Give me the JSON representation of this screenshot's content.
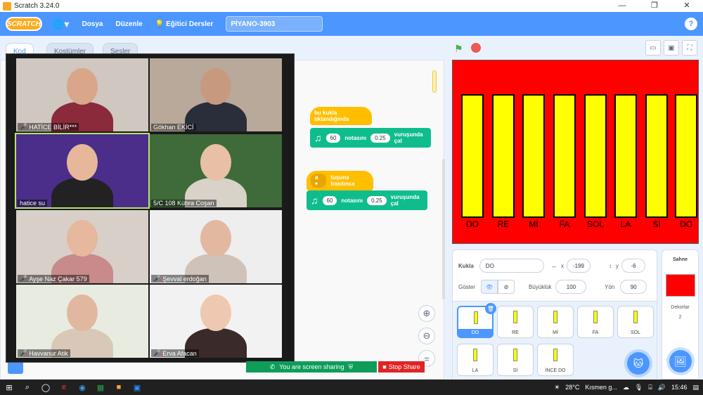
{
  "window": {
    "title": "Scratch 3.24.0",
    "controls": [
      "—",
      "❐",
      "✕"
    ]
  },
  "menubar": {
    "logo": "SCRATCH",
    "items": [
      "Dosya",
      "Düzenle"
    ],
    "tutorials": "Eğitici Dersler",
    "project_title": "PİYANO-3903",
    "help": "?"
  },
  "tabs": [
    "Kod",
    "Kostümler",
    "Sesler"
  ],
  "code": {
    "script1": {
      "hat": "bu kukla tıklandığında",
      "note": "60",
      "beat": "0.25",
      "text1": "notasını",
      "text2": "vuruşunda çal"
    },
    "script2": {
      "key": "a",
      "hat": "tuşuna basılınca",
      "note": "60",
      "beat": "0.25",
      "text1": "notasını",
      "text2": "vuruşunda çal"
    }
  },
  "participants": [
    {
      "name": "HATİCE BİLİR***",
      "muted": true,
      "bg": "#cfc7c0",
      "shirt": "#8a2a3a",
      "skin": "#d9a68a"
    },
    {
      "name": "Gökhan EKİCİ",
      "muted": false,
      "bg": "#b8a99a",
      "shirt": "#2a2e3a",
      "skin": "#c79a80"
    },
    {
      "name": "hatice su",
      "muted": false,
      "bg": "#4a2e8a",
      "shirt": "#222222",
      "skin": "#e6b79a"
    },
    {
      "name": "5/C 108 Kübra Coşan",
      "muted": false,
      "bg": "#3f6a3a",
      "shirt": "#d8d2c8",
      "skin": "#e8c0a6"
    },
    {
      "name": "Ayşe Naz Çakar 579",
      "muted": true,
      "bg": "#d8cfc8",
      "shirt": "#c88a8a",
      "skin": "#e6b89e"
    },
    {
      "name": "Şevval erdoğan",
      "muted": true,
      "bg": "#eeeeee",
      "shirt": "#cfc2b8",
      "skin": "#e3b8a0"
    },
    {
      "name": "Havvanur Atik",
      "muted": true,
      "bg": "#e8ece0",
      "shirt": "#d9c8b8",
      "skin": "#e2b7a0"
    },
    {
      "name": "Erva Afacan",
      "muted": true,
      "bg": "#f2f2f2",
      "shirt": "#3a2a2a",
      "skin": "#efc8b2"
    }
  ],
  "screen_share": {
    "status": "You are screen sharing",
    "stop": "Stop Share"
  },
  "stage": {
    "notes": [
      "DO",
      "RE",
      "Mİ",
      "FA",
      "SOL",
      "LA",
      "Sİ",
      "DO"
    ],
    "bg_color": "#ff0000",
    "key_color": "#ffff00"
  },
  "sprite_info": {
    "sprite_label": "Kukla",
    "sprite_name": "DO",
    "x_label": "x",
    "x": "-199",
    "y_label": "y",
    "y": "-6",
    "show_label": "Göster",
    "size_label": "Büyüklük",
    "size": "100",
    "direction_label": "Yön",
    "direction": "90"
  },
  "sprites": [
    "DO",
    "RE",
    "Mİ",
    "FA",
    "SOL",
    "LA",
    "Sİ",
    "İNCE DO"
  ],
  "stage_panel": {
    "title": "Sahne",
    "backdrops_label": "Dekorlar",
    "backdrops_count": "2"
  },
  "taskbar": {
    "weather": "28°C",
    "weather_text": "Kısmen g...",
    "time": "15:46"
  }
}
